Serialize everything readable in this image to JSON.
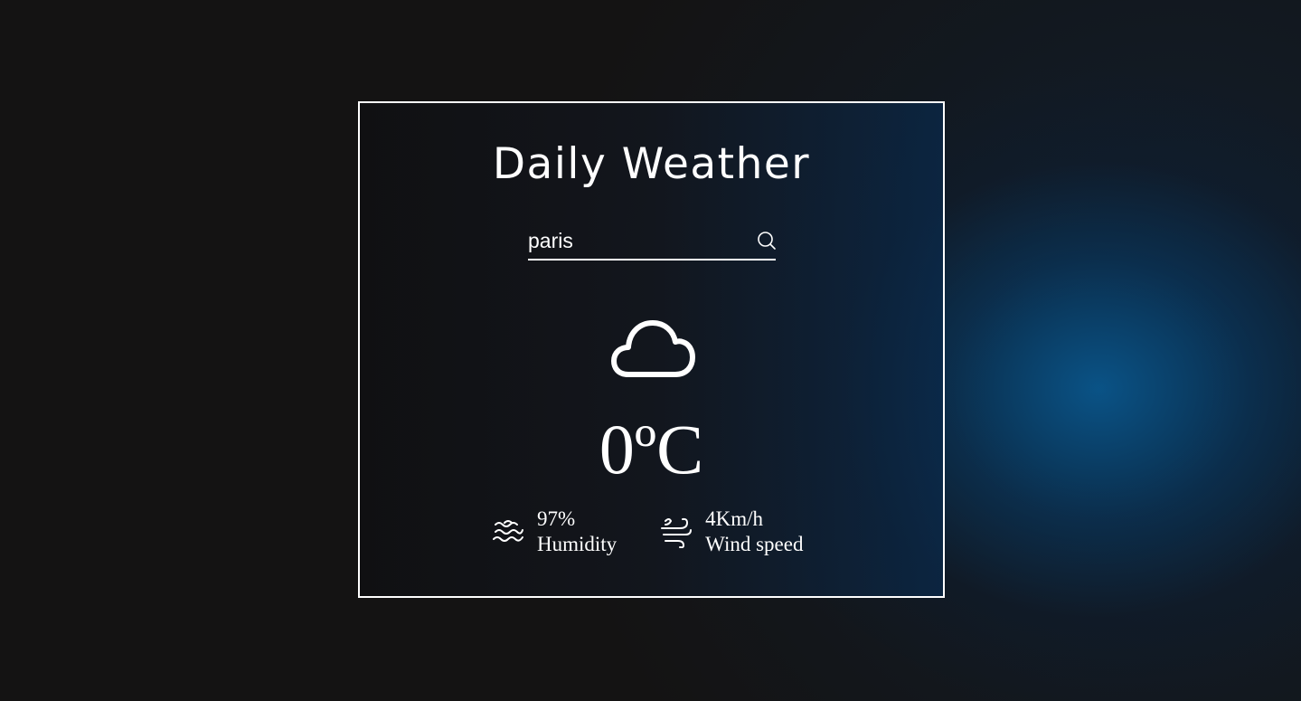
{
  "app": {
    "title": "Daily Weather"
  },
  "search": {
    "value": "paris",
    "placeholder": "",
    "icon": "search-icon"
  },
  "weather": {
    "condition_icon": "cloud-icon",
    "temperature": "0ºC"
  },
  "stats": {
    "humidity": {
      "value": "97%",
      "label": "Humidity",
      "icon": "humidity-icon"
    },
    "wind": {
      "value": "4Km/h",
      "label": "Wind speed",
      "icon": "wind-icon"
    }
  },
  "colors": {
    "text": "#ffffff",
    "background": "#141313",
    "accent_glow": "#085c96"
  }
}
